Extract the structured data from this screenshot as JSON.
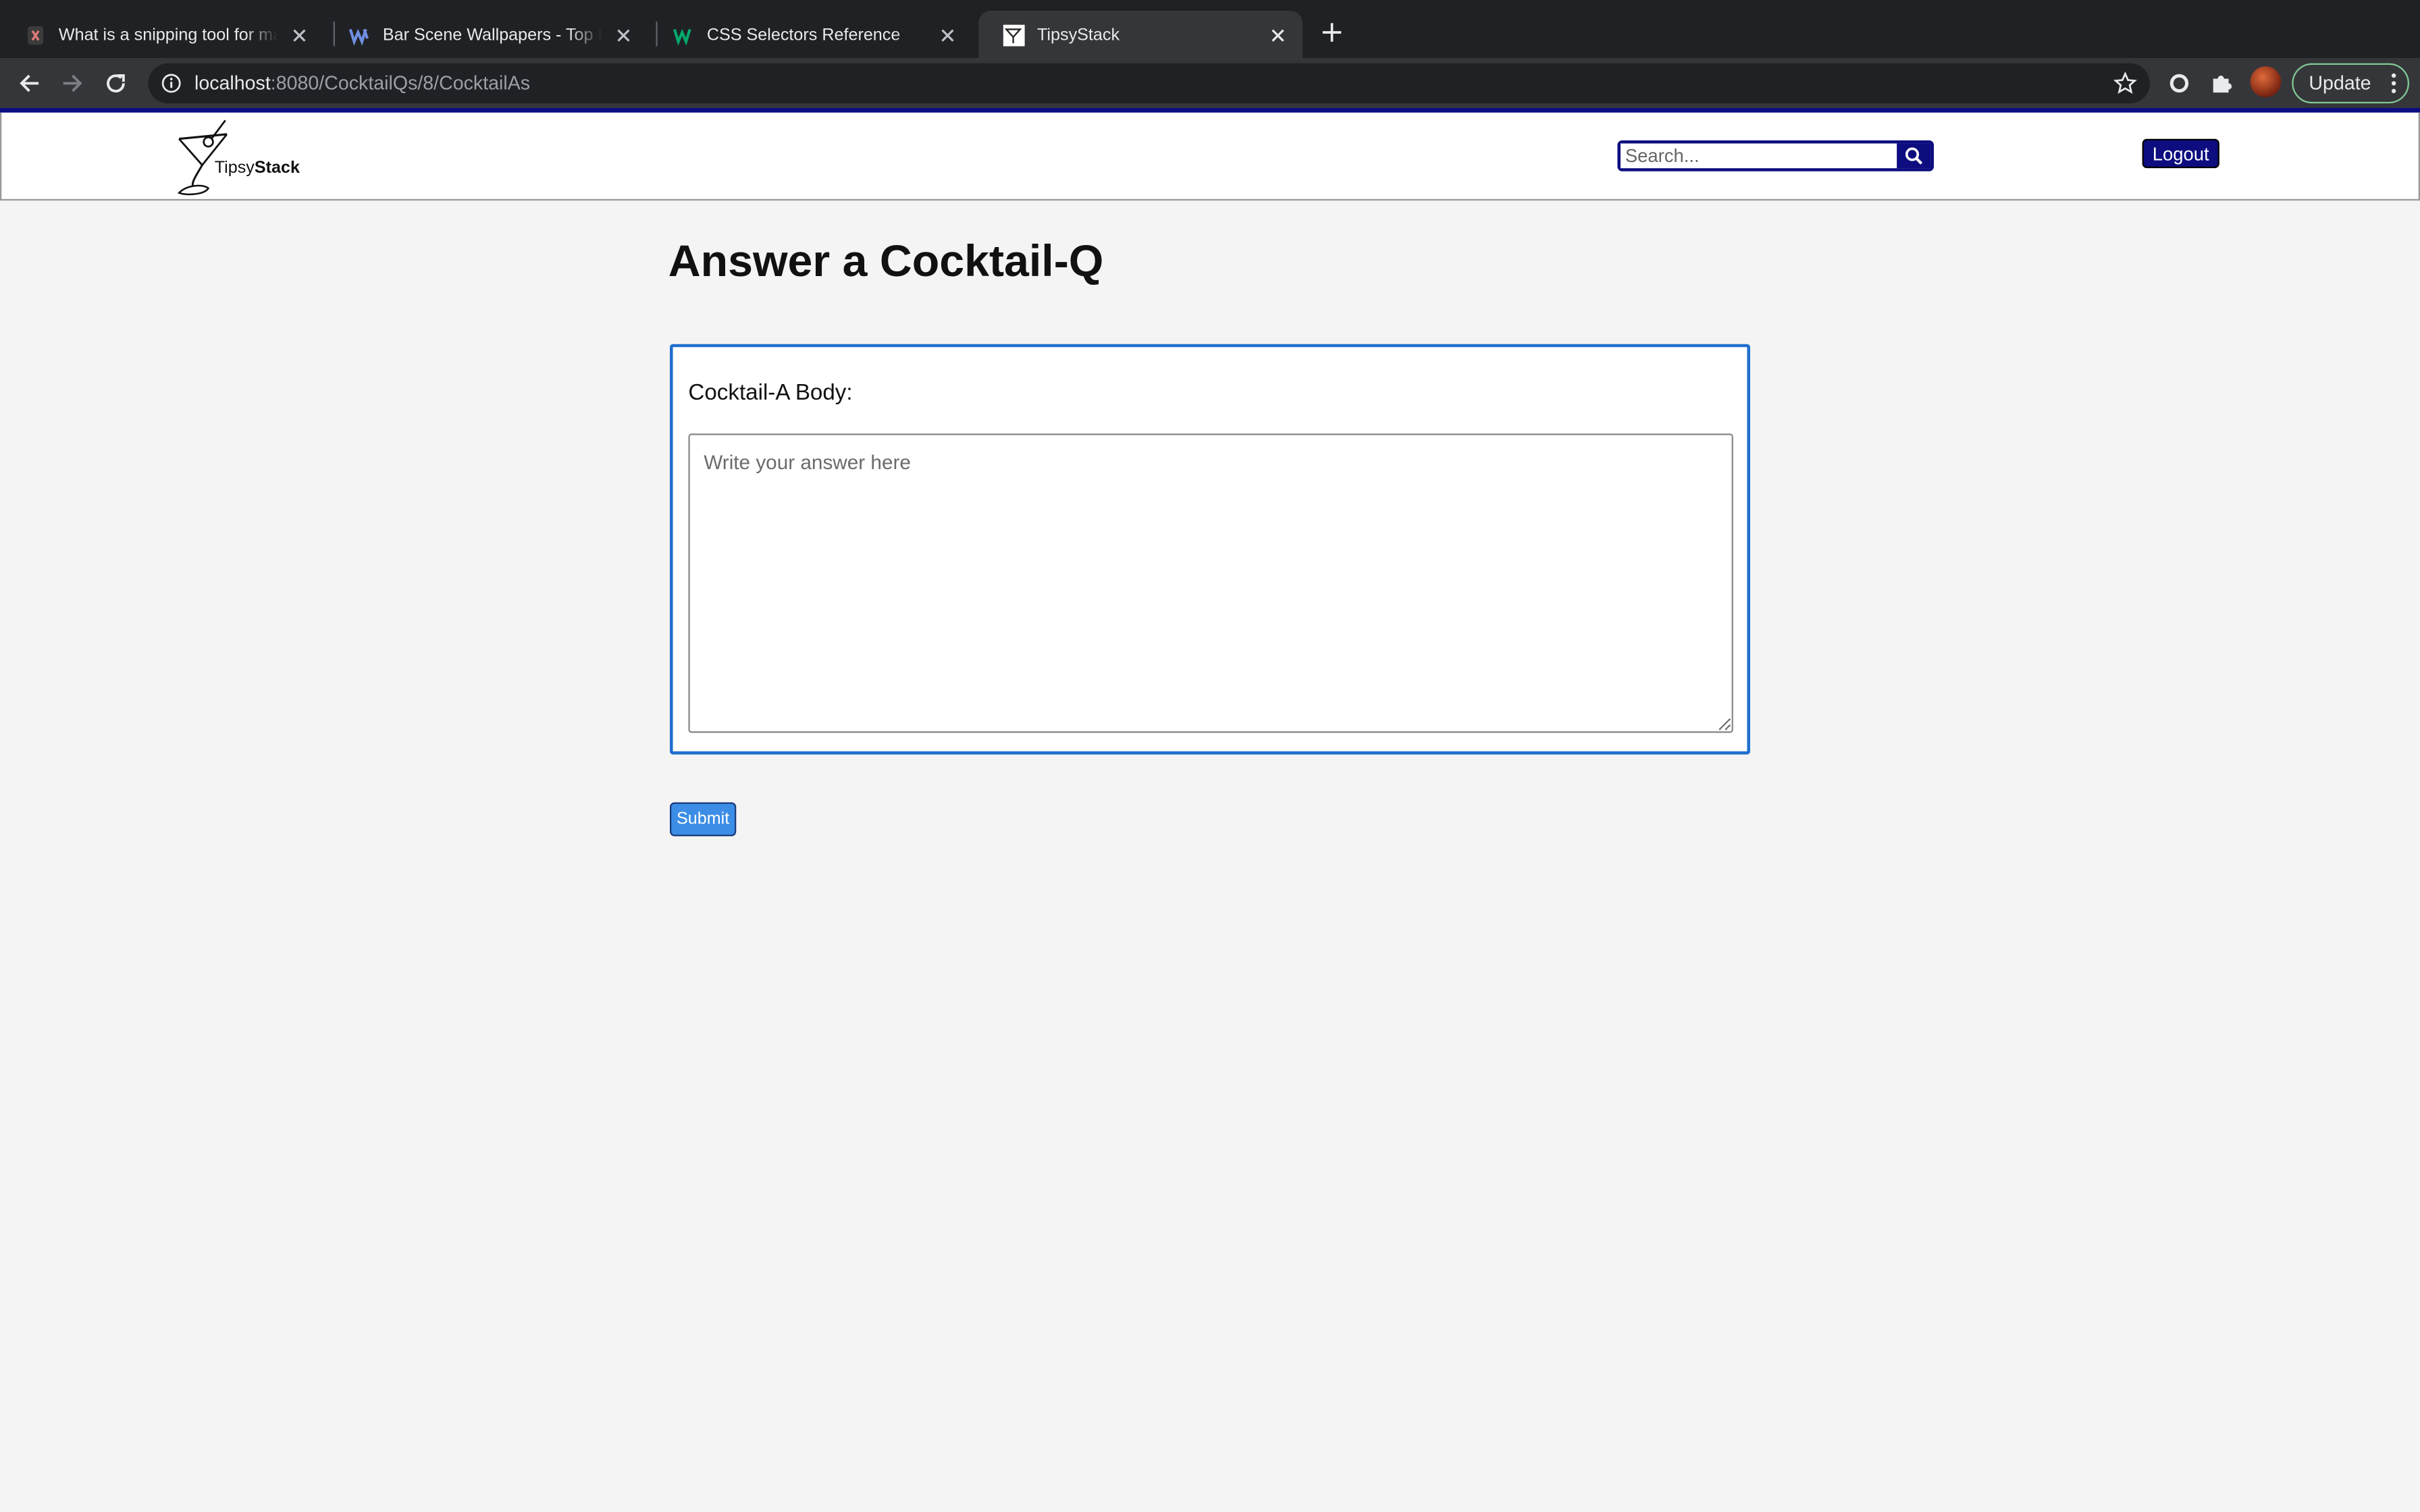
{
  "browser": {
    "tabs": [
      {
        "title": "What is a snipping tool for mac",
        "favicon": "snipping-favicon"
      },
      {
        "title": "Bar Scene Wallpapers - Top Free",
        "favicon": "wallpaper-favicon"
      },
      {
        "title": "CSS Selectors Reference",
        "favicon": "w3-favicon"
      },
      {
        "title": "TipsyStack",
        "favicon": "tipsystack-favicon",
        "active": true
      }
    ],
    "url_host": "localhost",
    "url_path": ":8080/CocktailQs/8/CocktailAs",
    "update_label": "Update"
  },
  "header": {
    "logo_text_light": "Tipsy",
    "logo_text_bold": "Stack",
    "search_placeholder": "Search...",
    "logout_label": "Logout",
    "accent_color": "#0d0d80"
  },
  "main": {
    "title": "Answer a Cocktail-Q",
    "body_label": "Cocktail-A Body:",
    "textarea_placeholder": "Write your answer here",
    "submit_label": "Submit",
    "card_border_color": "#1f6fcf",
    "submit_color": "#3b8de6"
  }
}
